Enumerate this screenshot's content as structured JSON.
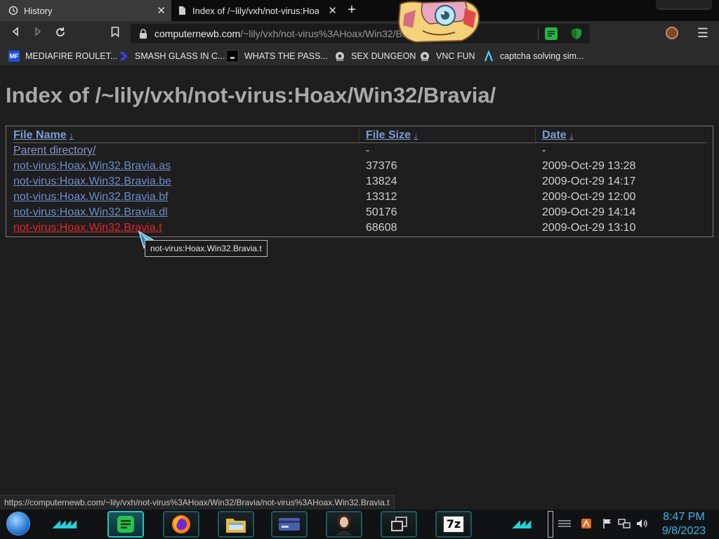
{
  "browser": {
    "tabs": [
      {
        "label": "History",
        "icon": "history-icon"
      },
      {
        "label": "Index of /~lily/vxh/not-virus:Hoax/",
        "icon": "page-icon"
      }
    ],
    "new_tab": "+",
    "url_host": "computernewb.com",
    "url_path": "/~lily/vxh/not-virus%3AHoax/Win32/Bravia/"
  },
  "bookmarks": [
    {
      "label": "MEDIAFIRE ROULET...",
      "icon": "mf-icon",
      "badge": "MF"
    },
    {
      "label": "SMASH GLASS IN C...",
      "icon": "chevron-logo-icon"
    },
    {
      "label": "WHATS THE PASS...",
      "icon": "dark-box-icon"
    },
    {
      "label": "SEX DUNGEON",
      "icon": "gear-badge-icon"
    },
    {
      "label": "VNC FUN",
      "icon": "gear-badge-icon"
    },
    {
      "label": "captcha solving sim...",
      "icon": "lambda-icon"
    }
  ],
  "page": {
    "title": "Index of /~lily/vxh/not-virus:Hoax/Win32/Bravia/",
    "headers": {
      "name": "File Name",
      "size": "File Size",
      "date": "Date",
      "sort_arrow": "↓"
    },
    "parent": {
      "name": "Parent directory/",
      "size": "-",
      "date": "-"
    },
    "files": [
      {
        "name": "not-virus:Hoax.Win32.Bravia.as",
        "size": "37376",
        "date": "2009-Oct-29 13:28"
      },
      {
        "name": "not-virus:Hoax.Win32.Bravia.be",
        "size": "13824",
        "date": "2009-Oct-29 14:17"
      },
      {
        "name": "not-virus:Hoax.Win32.Bravia.bf",
        "size": "13312",
        "date": "2009-Oct-29 12:00"
      },
      {
        "name": "not-virus:Hoax.Win32.Bravia.dl",
        "size": "50176",
        "date": "2009-Oct-29 14:14"
      },
      {
        "name": "not-virus:Hoax.Win32.Bravia.t",
        "size": "68608",
        "date": "2009-Oct-29 13:10"
      }
    ],
    "tooltip": "not-virus:Hoax.Win32.Bravia.t",
    "status_url": "https://computernewb.com/~lily/vxh/not-virus%3AHoax/Win32/Bravia/not-virus%3AHoax.Win32.Bravia.t"
  },
  "taskbar": {
    "apps": [
      "notes-app-icon",
      "firefox-icon",
      "file-explorer-icon",
      "control-panel-icon",
      "portrait-app-icon",
      "task-view-icon",
      "7zip-icon"
    ],
    "zip_label": "7z",
    "time": "8:47 PM",
    "date": "9/8/2023"
  },
  "colors": {
    "link": "#6c8ecb",
    "hover_link": "#e0262a",
    "accent": "#25c3c8",
    "clock": "#3fb6ea"
  }
}
